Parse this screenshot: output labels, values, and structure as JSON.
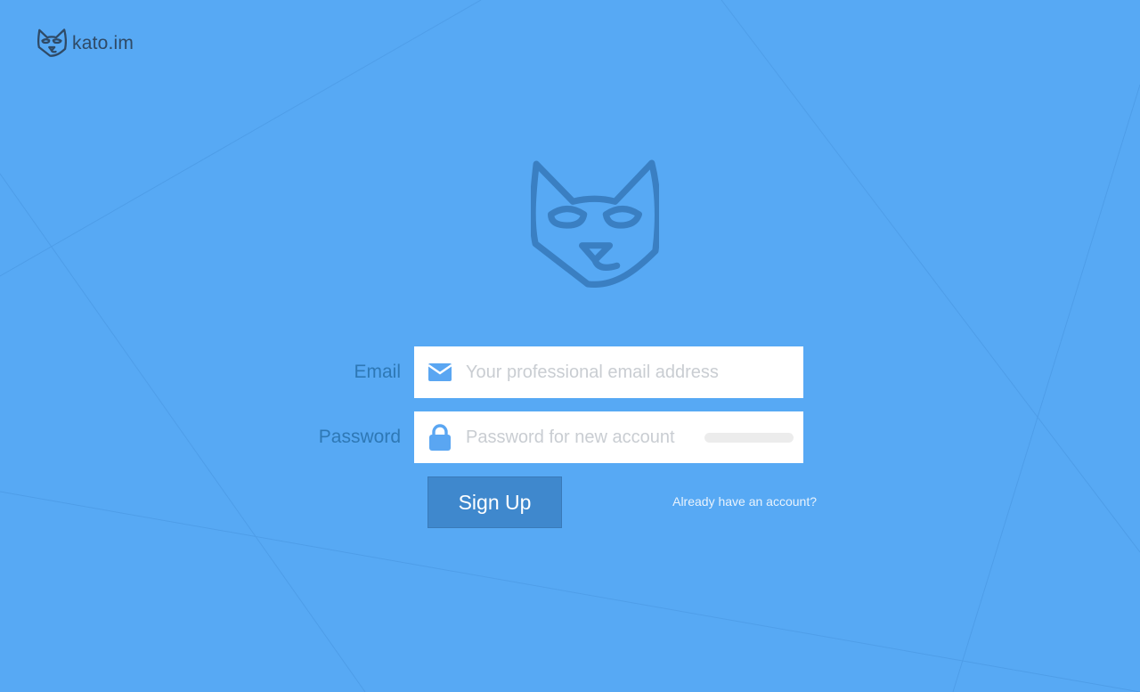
{
  "brand": {
    "name": "kato.im",
    "logo_icon": "cat-face-icon"
  },
  "colors": {
    "background": "#57a9f4",
    "label_text": "#2e78b5",
    "button_bg": "#3f88cd",
    "icon_color": "#5aa6f2",
    "cat_outline": "#3a7fc2"
  },
  "form": {
    "email": {
      "label": "Email",
      "placeholder": "Your professional email address",
      "value": "",
      "icon": "envelope-icon"
    },
    "password": {
      "label": "Password",
      "placeholder": "Password for new account",
      "value": "",
      "icon": "lock-icon",
      "strength": 0
    },
    "submit_label": "Sign Up",
    "login_link": "Already have an account?"
  }
}
